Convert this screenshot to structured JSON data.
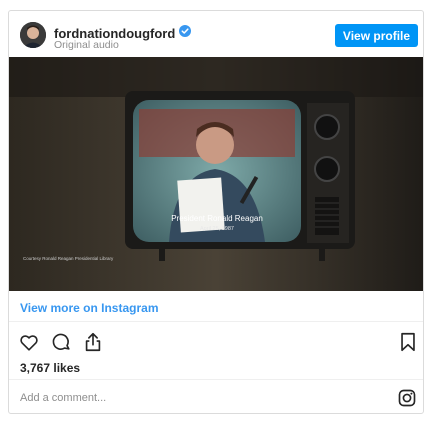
{
  "post": {
    "username": "fordnationdougford",
    "subtitle": "Original audio",
    "view_profile_label": "View profile",
    "verified": true
  },
  "video": {
    "caption_name": "President Ronald Reagan",
    "caption_date": "April 25, 1987",
    "credit": "Courtesy Ronald Reagan Presidential Library"
  },
  "links": {
    "view_more": "View more on Instagram"
  },
  "stats": {
    "likes": "3,767 likes"
  },
  "comment": {
    "placeholder": "Add a comment..."
  },
  "icons": [
    "verified-icon",
    "heart-icon",
    "comment-icon",
    "share-icon",
    "bookmark-icon",
    "instagram-icon"
  ],
  "colors": {
    "accent": "#0095f6",
    "link": "#3897f0",
    "muted": "#8e8e8e"
  }
}
